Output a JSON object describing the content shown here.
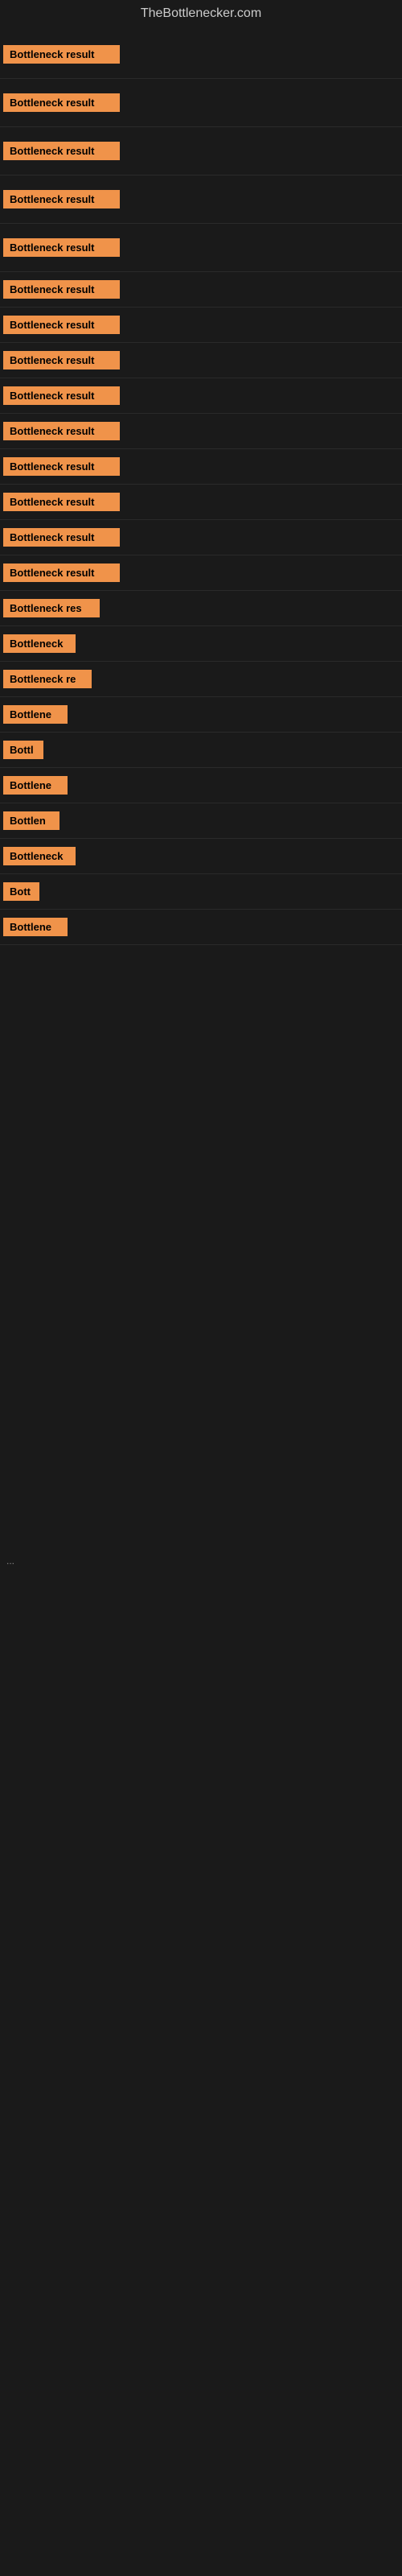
{
  "site": {
    "title": "TheBottlenecker.com"
  },
  "items": [
    {
      "id": 1,
      "label": "Bottleneck result",
      "badgeClass": "badge-full",
      "spacing": "large"
    },
    {
      "id": 2,
      "label": "Bottleneck result",
      "badgeClass": "badge-full",
      "spacing": "large"
    },
    {
      "id": 3,
      "label": "Bottleneck result",
      "badgeClass": "badge-full",
      "spacing": "large"
    },
    {
      "id": 4,
      "label": "Bottleneck result",
      "badgeClass": "badge-full",
      "spacing": "large"
    },
    {
      "id": 5,
      "label": "Bottleneck result",
      "badgeClass": "badge-full",
      "spacing": "large"
    },
    {
      "id": 6,
      "label": "Bottleneck result",
      "badgeClass": "badge-full",
      "spacing": "normal"
    },
    {
      "id": 7,
      "label": "Bottleneck result",
      "badgeClass": "badge-full",
      "spacing": "normal"
    },
    {
      "id": 8,
      "label": "Bottleneck result",
      "badgeClass": "badge-full",
      "spacing": "normal"
    },
    {
      "id": 9,
      "label": "Bottleneck result",
      "badgeClass": "badge-full",
      "spacing": "normal"
    },
    {
      "id": 10,
      "label": "Bottleneck result",
      "badgeClass": "badge-full",
      "spacing": "normal"
    },
    {
      "id": 11,
      "label": "Bottleneck result",
      "badgeClass": "badge-full",
      "spacing": "normal"
    },
    {
      "id": 12,
      "label": "Bottleneck result",
      "badgeClass": "badge-full",
      "spacing": "normal"
    },
    {
      "id": 13,
      "label": "Bottleneck result",
      "badgeClass": "badge-full",
      "spacing": "normal"
    },
    {
      "id": 14,
      "label": "Bottleneck result",
      "badgeClass": "badge-full",
      "spacing": "normal"
    },
    {
      "id": 15,
      "label": "Bottleneck res",
      "badgeClass": "badge-w120",
      "spacing": "normal"
    },
    {
      "id": 16,
      "label": "Bottleneck",
      "badgeClass": "badge-w90",
      "spacing": "normal"
    },
    {
      "id": 17,
      "label": "Bottleneck re",
      "badgeClass": "badge-w110",
      "spacing": "normal"
    },
    {
      "id": 18,
      "label": "Bottlene",
      "badgeClass": "badge-w80",
      "spacing": "normal"
    },
    {
      "id": 19,
      "label": "Bottl",
      "badgeClass": "badge-w50",
      "spacing": "normal"
    },
    {
      "id": 20,
      "label": "Bottlene",
      "badgeClass": "badge-w80",
      "spacing": "normal"
    },
    {
      "id": 21,
      "label": "Bottlen",
      "badgeClass": "badge-w70",
      "spacing": "normal"
    },
    {
      "id": 22,
      "label": "Bottleneck",
      "badgeClass": "badge-w90",
      "spacing": "normal"
    },
    {
      "id": 23,
      "label": "Bott",
      "badgeClass": "badge-w45",
      "spacing": "normal"
    },
    {
      "id": 24,
      "label": "Bottlene",
      "badgeClass": "badge-w80",
      "spacing": "normal"
    }
  ],
  "dots": "..."
}
